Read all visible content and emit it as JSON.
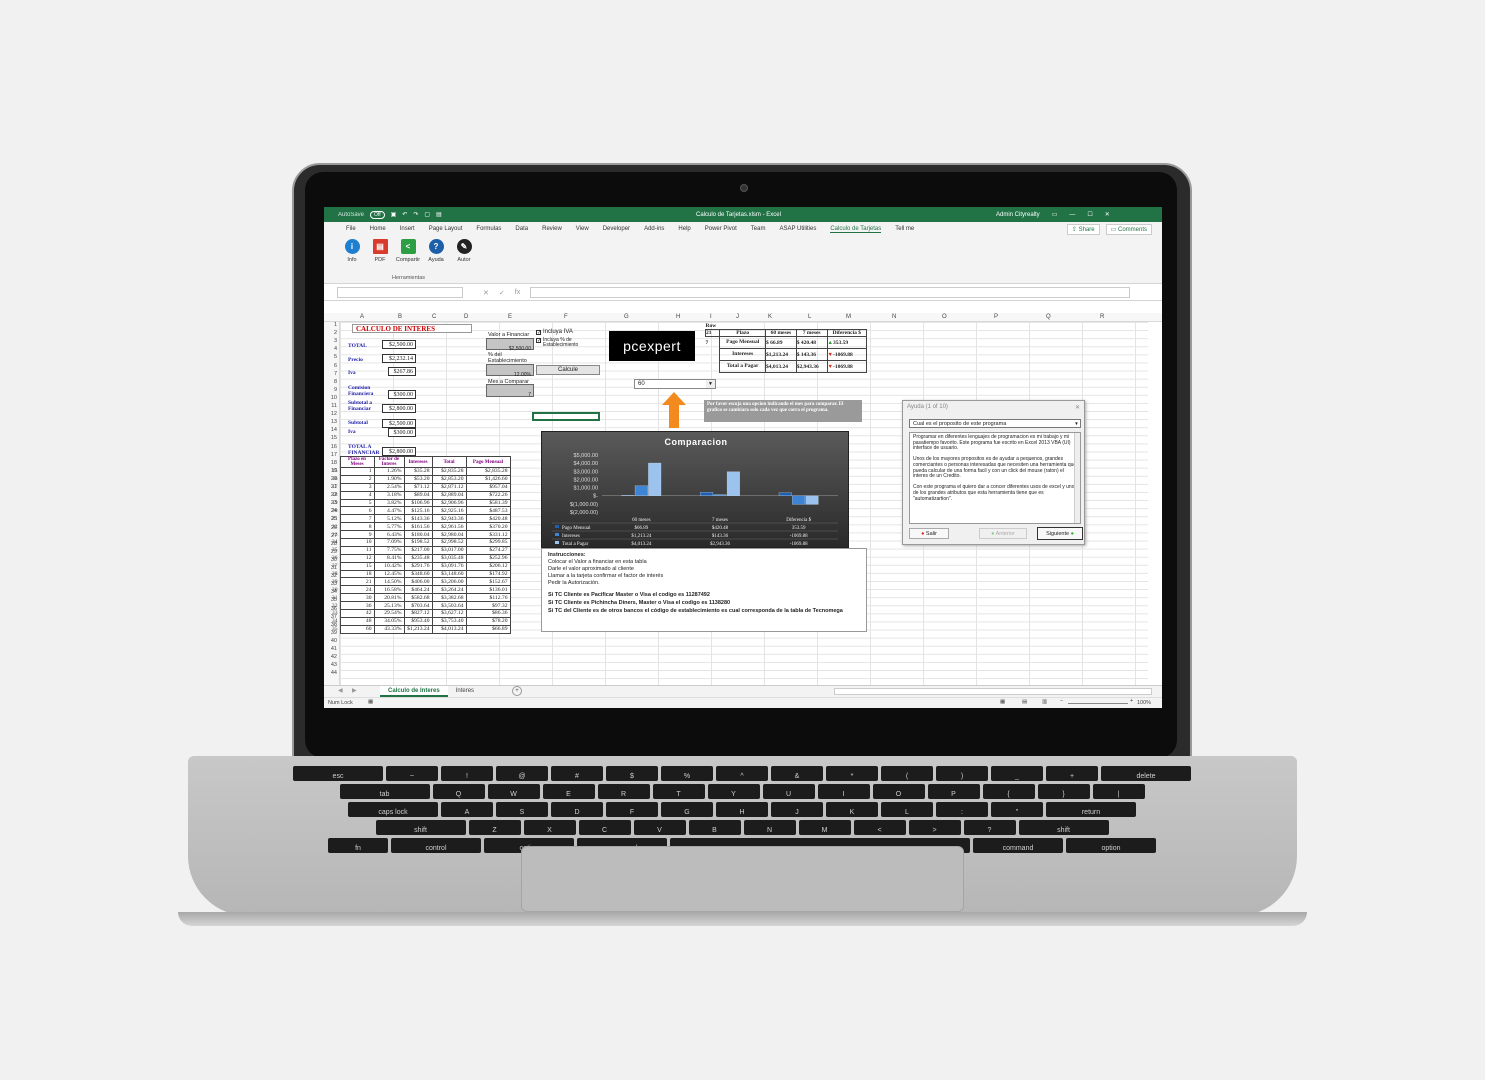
{
  "excel": {
    "title": "Calculo de Tarjetas.xlsm  -  Excel",
    "user": "Admin Cityrealty",
    "autosave": "AutoSave",
    "autosave_state": "Off",
    "menu": [
      "File",
      "Home",
      "Insert",
      "Page Layout",
      "Formulas",
      "Data",
      "Review",
      "View",
      "Developer",
      "Add-ins",
      "Help",
      "Power Pivot",
      "Team",
      "ASAP Utilities",
      "Calculo de Tarjetas",
      "Tell me"
    ],
    "active_menu": "Calculo de Tarjetas",
    "share": "Share",
    "comments": "Comments",
    "ribbon_buttons": [
      {
        "label": "Info",
        "icon": "info-icon",
        "color": "#1e7fd0"
      },
      {
        "label": "PDF",
        "icon": "pdf-icon",
        "color": "#d83a2c"
      },
      {
        "label": "Compartir",
        "icon": "share-icon",
        "color": "#2e9e44"
      },
      {
        "label": "Ayuda",
        "icon": "help-icon",
        "color": "#1d5fa8"
      },
      {
        "label": "Autor",
        "icon": "author-icon",
        "color": "#222"
      }
    ],
    "ribbon_group": "Herramientas",
    "columns": [
      "A",
      "B",
      "C",
      "D",
      "E",
      "F",
      "G",
      "H",
      "I",
      "J",
      "K",
      "L",
      "M",
      "N",
      "O",
      "P",
      "Q",
      "R"
    ],
    "sheet_title": "CALCULO DE INTERES",
    "labels": {
      "total": "TOTAL",
      "precio": "Precio",
      "iva": "Iva",
      "comision": "Comision Financiera",
      "subtotal_fin": "Subtotal a Financiar",
      "subtotal": "Subtotal",
      "iva2": "Iva",
      "total_fin": "TOTAL A FINANCIAR"
    },
    "values": {
      "total": "$2,500.00",
      "precio": "$2,232.14",
      "iva": "$267.86",
      "comision": "$300.00",
      "subtotal_fin": "$2,800.00",
      "subtotal": "$2,500.00",
      "iva2": "$300.00",
      "total_fin": "$2,800.00"
    },
    "inputs": {
      "valor_label": "Valor a Financiar",
      "valor": "$2,500.00",
      "pct_label": "% del Establecimiento",
      "pct": "12.00%",
      "mes_label": "Mes a Comparar",
      "mes": "7",
      "iva_check": "Incluya IVA",
      "est_check": "Incluya % de Establecimiento",
      "calc_button": "Calcule",
      "dropdown": "60"
    },
    "logo": "pcexpert",
    "hint": "Por favor escoja una opcion indicando el mes para comparar. El grafico se cambiara solo cada vez que corra el programa.",
    "table_headers": [
      "Plazo en Meses",
      "Factor de Interes",
      "Intereses",
      "Total",
      "Pago Mensual"
    ],
    "table_rows": [
      [
        "15",
        "1",
        "1.26%",
        "$35.28",
        "$2,835.28",
        "$2,835.28"
      ],
      [
        "16",
        "2",
        "1.90%",
        "$53.20",
        "$2,853.20",
        "$1,426.60"
      ],
      [
        "17",
        "3",
        "2.54%",
        "$71.12",
        "$2,871.12",
        "$957.04"
      ],
      [
        "18",
        "4",
        "3.18%",
        "$89.04",
        "$2,889.04",
        "$722.26"
      ],
      [
        "19",
        "5",
        "3.82%",
        "$106.96",
        "$2,906.96",
        "$581.39"
      ],
      [
        "20",
        "6",
        "4.47%",
        "$125.16",
        "$2,925.16",
        "$487.53"
      ],
      [
        "21",
        "7",
        "5.12%",
        "$143.36",
        "$2,943.36",
        "$420.48"
      ],
      [
        "22",
        "8",
        "5.77%",
        "$161.56",
        "$2,961.56",
        "$370.20"
      ],
      [
        "23",
        "9",
        "6.43%",
        "$180.04",
        "$2,980.04",
        "$331.12"
      ],
      [
        "24",
        "10",
        "7.09%",
        "$198.52",
        "$2,998.52",
        "$299.85"
      ],
      [
        "25",
        "11",
        "7.75%",
        "$217.00",
        "$3,017.00",
        "$274.27"
      ],
      [
        "26",
        "12",
        "8.41%",
        "$235.48",
        "$3,035.48",
        "$252.96"
      ],
      [
        "27",
        "15",
        "10.42%",
        "$291.76",
        "$3,091.76",
        "$206.12"
      ],
      [
        "28",
        "18",
        "12.45%",
        "$348.60",
        "$3,148.60",
        "$174.92"
      ],
      [
        "29",
        "21",
        "14.50%",
        "$406.00",
        "$3,206.00",
        "$152.67"
      ],
      [
        "30",
        "24",
        "16.58%",
        "$464.24",
        "$3,264.24",
        "$136.01"
      ],
      [
        "31",
        "30",
        "20.81%",
        "$582.68",
        "$3,382.68",
        "$112.76"
      ],
      [
        "32",
        "36",
        "25.13%",
        "$703.64",
        "$3,503.64",
        "$97.32"
      ],
      [
        "33",
        "42",
        "29.54%",
        "$827.12",
        "$3,627.12",
        "$86.36"
      ],
      [
        "34",
        "48",
        "34.05%",
        "$953.40",
        "$3,753.40",
        "$78.20"
      ],
      [
        "35",
        "60",
        "43.33%",
        "$1,213.24",
        "$4,013.24",
        "$66.89"
      ]
    ],
    "right_table": {
      "row_label": "Row",
      "row_num": "21",
      "headers": [
        "Plazo",
        "60 meses",
        "7 meses",
        "Diferencia $"
      ],
      "rows": [
        {
          "rownum": "7",
          "label": "Pago Mensual",
          "a": "$ 66.89",
          "b": "$ 420.48",
          "d": "353.59",
          "arrow": "up"
        },
        {
          "rownum": "",
          "label": "Intereses",
          "a": "$1,213.24",
          "b": "$ 143.36",
          "d": "-1069.88",
          "arrow": "down"
        },
        {
          "rownum": "",
          "label": "Total a Pagar",
          "a": "$4,013.24",
          "b": "$2,943.36",
          "d": "-1069.88",
          "arrow": "down"
        }
      ]
    },
    "instructions": {
      "heading": "Instrucciones:",
      "lines": [
        "Colocar el Valor a financiar en esta tabla",
        "Darle el valor aproximado al cliente",
        "Llamar a la tarjeta confirmar el factor de interés",
        "Pedir la Autorización."
      ],
      "bold_lines": [
        "Si TC Cliente es Pacificar Master o Visa el codigo es 11287492",
        "Si TC Cliente es Pichincha Diners,  Master o Visa el codigo es 1138280",
        "Si TC del Cliente es de otros bancos el código de establecimiento es cual corresponda de la tabla de Tecnomega"
      ]
    },
    "dialog": {
      "title": "Ayuda (1 of 10)",
      "select": "Cual es el proposito de este programa",
      "body1": "Programar en diferentes lenguajes de programacion es mi trabajo y mi pasatiempo favorito. Este programa fue escrito en Excel 2013 VBA (UI) interface de usuario.",
      "body2": "Unos de los mayores propositos es de ayudar a pequenos, grandes comerciantes o personas interesadas que necesiten una herramienta que pueda calcular de una forma facil y con un click del mouse (raton) el interes de un Credito.",
      "body3": "Con este programa el quiero dar a concer diferentes usos de excel y unos de los grandes atributos que esta herramienta tiene que es \"automatizartion\".",
      "btn_exit": "Salir",
      "btn_prev": "Anterior",
      "btn_next": "Siguiente"
    },
    "sheet_tabs": [
      "Calculo de Interes",
      "Interes"
    ],
    "status": "Num Lock",
    "zoom": "100%"
  },
  "chart_data": {
    "type": "bar",
    "title": "Comparacion",
    "categories": [
      "60 meses",
      "7 meses",
      "Diferencia $"
    ],
    "series": [
      {
        "name": "Pago Mensual",
        "values": [
          66.89,
          420.48,
          353.59
        ]
      },
      {
        "name": "Intereses",
        "values": [
          1213.24,
          143.36,
          -1069.88
        ]
      },
      {
        "name": "Total a Pagar",
        "values": [
          4013.24,
          2943.36,
          -1069.88
        ]
      }
    ],
    "table_cells": [
      [
        "$66.89",
        "$420.48",
        "353.59"
      ],
      [
        "$1,213.24",
        "$143.36",
        "-1069.88"
      ],
      [
        "$4,013.24",
        "$2,943.36",
        "-1069.88"
      ]
    ],
    "ylim": [
      -2000,
      5000
    ],
    "yticks": [
      "$5,000.00",
      "$4,000.00",
      "$3,000.00",
      "$2,000.00",
      "$1,000.00",
      "$-",
      "$(1,000.00)",
      "$(2,000.00)"
    ],
    "legend": "bottom-table"
  },
  "keyboard": {
    "row1": [
      "esc",
      "~",
      "!",
      "@",
      "#",
      "$",
      "%",
      "^",
      "&",
      "*",
      "(",
      ")",
      "_",
      "+",
      "delete"
    ],
    "row2": [
      "tab",
      "Q",
      "W",
      "E",
      "R",
      "T",
      "Y",
      "U",
      "I",
      "O",
      "P",
      "{",
      "}",
      "|"
    ],
    "row3": [
      "caps lock",
      "A",
      "S",
      "D",
      "F",
      "G",
      "H",
      "J",
      "K",
      "L",
      ":",
      "\"",
      "return"
    ],
    "row4": [
      "shift",
      "Z",
      "X",
      "C",
      "V",
      "B",
      "N",
      "M",
      "<",
      ">",
      "?",
      "shift"
    ],
    "row5": [
      "fn",
      "control",
      "option",
      "command",
      "",
      "command",
      "option"
    ]
  }
}
